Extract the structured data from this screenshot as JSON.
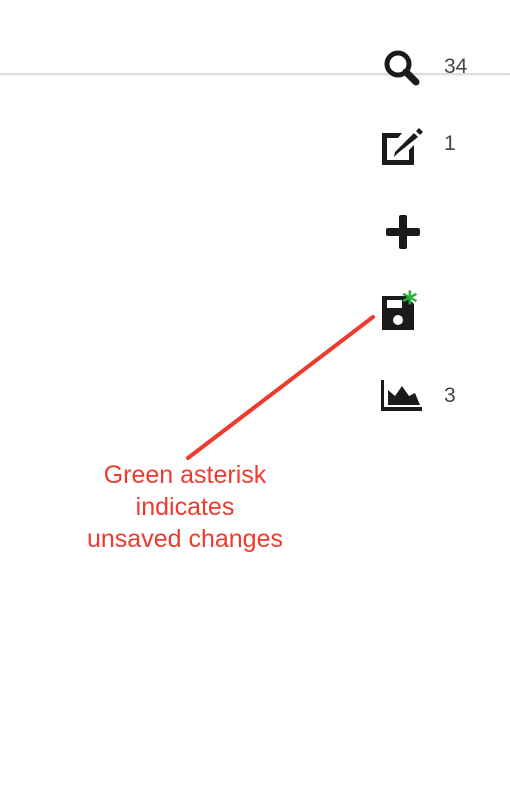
{
  "toolbar": {
    "search": {
      "icon": "search-icon",
      "count": "34"
    },
    "edit": {
      "icon": "edit-icon",
      "count": "1"
    },
    "add": {
      "icon": "plus-icon"
    },
    "save": {
      "icon": "save-icon",
      "unsaved_marker": "*"
    },
    "chart": {
      "icon": "area-chart-icon",
      "count": "3"
    }
  },
  "annotation": {
    "lines": [
      "Green asterisk",
      "indicates",
      "unsaved changes"
    ]
  },
  "colors": {
    "icon": "#1a1a1a",
    "count_text": "#444444",
    "asterisk": "#22b33a",
    "annotation": "#f03a2e"
  }
}
